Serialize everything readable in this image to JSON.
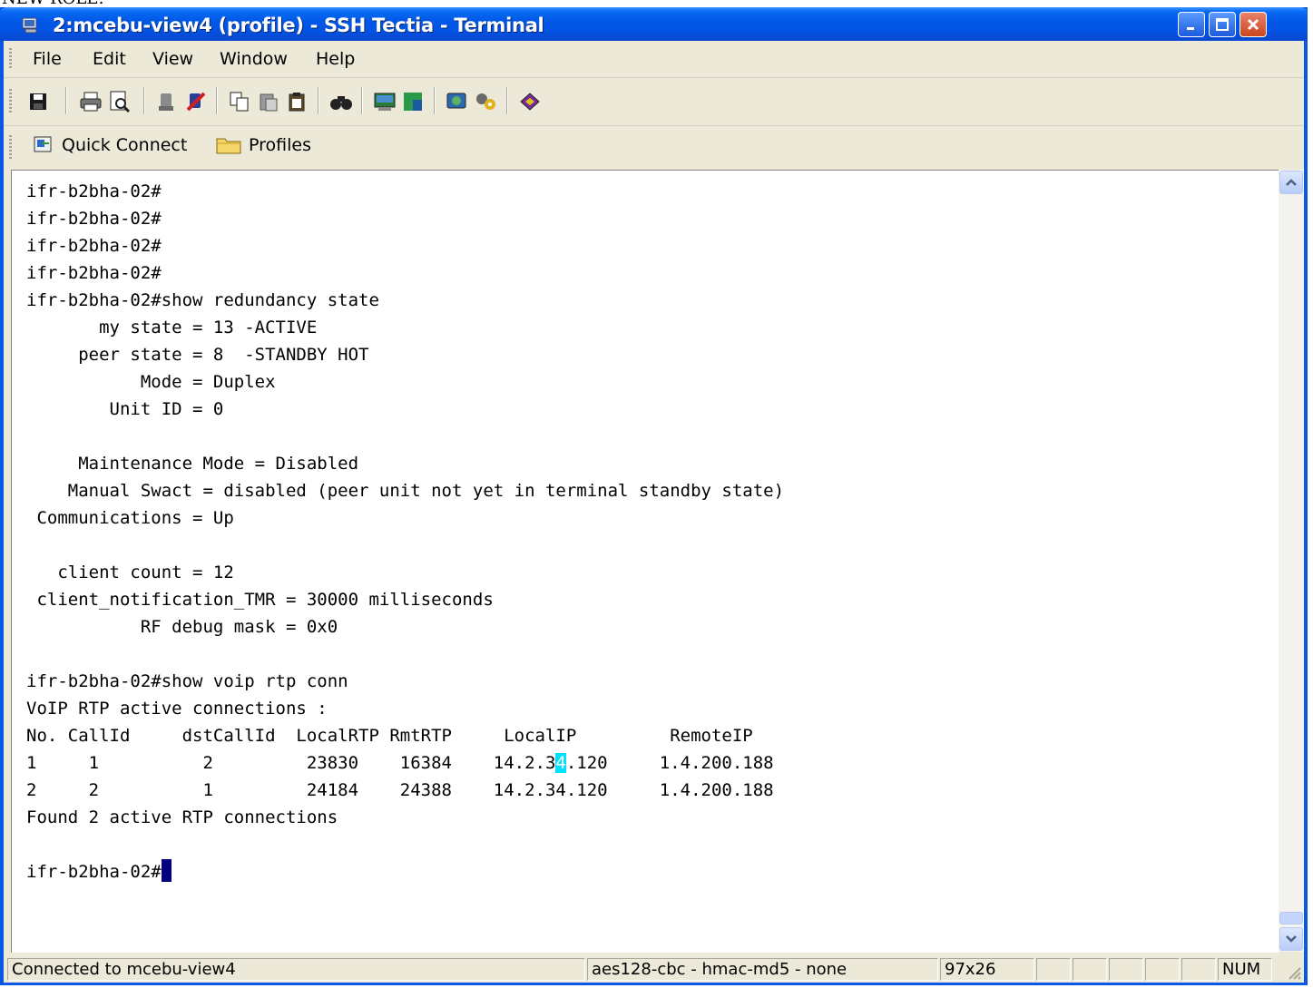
{
  "top_fragment": "NEW ROLE:",
  "window": {
    "title": "2:mcebu-view4 (profile) - SSH Tectia - Terminal",
    "controls": [
      "minimize",
      "maximize",
      "close"
    ]
  },
  "menu": {
    "file": "File",
    "edit": "Edit",
    "view": "View",
    "window": "Window",
    "help": "Help"
  },
  "toolbar": {
    "icons": [
      "save-icon",
      "print-icon",
      "print-preview-icon",
      "connect-icon",
      "disconnect-icon",
      "copy-icon",
      "paste-icon",
      "paste-special-icon",
      "find-icon",
      "new-terminal-icon",
      "new-file-transfer-icon",
      "settings-icon",
      "profile-settings-icon",
      "help-icon"
    ]
  },
  "quick_bar": {
    "quick_connect": "Quick Connect",
    "profiles": "Profiles"
  },
  "terminal": {
    "lines": [
      "ifr-b2bha-02#",
      "ifr-b2bha-02#",
      "ifr-b2bha-02#",
      "ifr-b2bha-02#",
      "ifr-b2bha-02#show redundancy state",
      "       my state = 13 -ACTIVE",
      "     peer state = 8  -STANDBY HOT",
      "           Mode = Duplex",
      "        Unit ID = 0",
      "",
      "     Maintenance Mode = Disabled",
      "    Manual Swact = disabled (peer unit not yet in terminal standby state)",
      " Communications = Up",
      "",
      "   client count = 12",
      " client_notification_TMR = 30000 milliseconds",
      "           RF debug mask = 0x0",
      "",
      "ifr-b2bha-02#show voip rtp conn",
      "VoIP RTP active connections :",
      "No. CallId     dstCallId  LocalRTP RmtRTP     LocalIP         RemoteIP",
      "2     2          1         24184    24388    14.2.34.120     1.4.200.188",
      "Found 2 active RTP connections",
      ""
    ],
    "row1_before": "1     1          2         23830    16384    14.2.3",
    "row1_highlight": "4",
    "row1_after": ".120     1.4.200.188",
    "prompt": "ifr-b2bha-02#"
  },
  "status": {
    "connection": "Connected to mcebu-view4",
    "cipher": "aes128-cbc - hmac-md5 - none",
    "size": "97x26",
    "num": "NUM"
  }
}
